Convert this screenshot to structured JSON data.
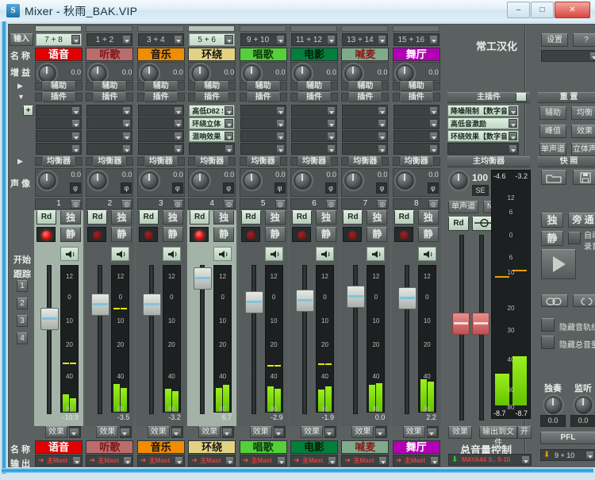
{
  "window": {
    "title": "Mixer -  秋雨_BAK.VIP",
    "logo": "S",
    "minimize": "–",
    "maximize": "□",
    "close": "✕"
  },
  "branding": "常工汉化",
  "toolbar": {
    "settings": "设置",
    "help": "?",
    "preset": ""
  },
  "left_labels": {
    "input": "输入",
    "name": "名 称",
    "gain": "增 益",
    "aux_toggle": "▶",
    "plugin_toggle": "▼",
    "add": "+",
    "eq_toggle": "▶",
    "pan": "声 像",
    "start": "开始",
    "track": "跟踪",
    "track_buttons": [
      "1",
      "2",
      "3",
      "4"
    ],
    "name_bottom": "名 称",
    "output": "输 出"
  },
  "headers": {
    "aux": "辅助",
    "plugin": "插件",
    "eq": "均衡器"
  },
  "meter_scale": [
    "12",
    "0",
    "10",
    "20",
    "40",
    "80"
  ],
  "meter_scale_pos": [
    9,
    35,
    65,
    95,
    135,
    176
  ],
  "master_meter_scale": [
    "12",
    "6",
    "0",
    "6",
    "10",
    "20",
    "30",
    "40",
    "60",
    "80"
  ],
  "master_meter_scale_pos": [
    30,
    48,
    77,
    105,
    124,
    169,
    197,
    234,
    272,
    294
  ],
  "channels": [
    {
      "num": "1",
      "input": "7 + 8",
      "name": "语音",
      "color": "#e00000",
      "text_color": "#ffffff",
      "gain": "0.0",
      "pan": "0.0",
      "phase": "φ",
      "plugins": [
        "",
        "",
        "",
        ""
      ],
      "rd": "Rd",
      "solo": "独",
      "mute": "静",
      "level": "-10.9",
      "fx": "效果",
      "output": "主Mast",
      "selected": true,
      "record_on": true,
      "fader_center": 370,
      "meter": [
        22,
        17
      ],
      "peak": 122
    },
    {
      "num": "2",
      "input": "1 + 2",
      "name": "听歌",
      "color": "#b96d6d",
      "text_color": "#7d1616",
      "gain": "0.0",
      "pan": "0.0",
      "phase": "φ",
      "plugins": [
        "",
        "",
        "",
        ""
      ],
      "rd": "Rd",
      "solo": "独",
      "mute": "静",
      "level": "-3.5",
      "fx": "效果",
      "output": "主Mast",
      "selected": false,
      "record_on": false,
      "fader_center": 352,
      "meter": [
        35,
        30
      ],
      "peak": 53
    },
    {
      "num": "3",
      "input": "3 + 4",
      "name": "音乐",
      "color": "#f08c00",
      "text_color": "#101010",
      "gain": "0.0",
      "pan": "0.0",
      "phase": "φ",
      "plugins": [
        "",
        "",
        "",
        ""
      ],
      "rd": "Rd",
      "solo": "独",
      "mute": "静",
      "level": "-3.2",
      "fx": "效果",
      "output": "主Mast",
      "selected": false,
      "record_on": false,
      "fader_center": 352,
      "meter": [
        29,
        26
      ],
      "peak": null
    },
    {
      "num": "4",
      "input": "5 + 6",
      "name": "环绕",
      "color": "#e2d283",
      "text_color": "#161616",
      "gain": "0.0",
      "pan": "0.0",
      "phase": "φ",
      "plugins": [
        "高低D82 S",
        "环绕立体",
        "混响效果",
        ""
      ],
      "rd": "Rd",
      "solo": "独",
      "mute": "静",
      "level": "6.7",
      "fx": "效果",
      "output": "主Mast",
      "selected": true,
      "record_on": true,
      "fader_center": 319,
      "meter": [
        30,
        34
      ],
      "peak": null
    },
    {
      "num": "5",
      "input": "9 + 10",
      "name": "唱歌",
      "color": "#54d039",
      "text_color": "#103810",
      "gain": "0.0",
      "pan": "0.0",
      "phase": "φ",
      "plugins": [
        "",
        "",
        "",
        ""
      ],
      "rd": "Rd",
      "solo": "独",
      "mute": "静",
      "level": "-2.9",
      "fx": "效果",
      "output": "主Mast",
      "selected": false,
      "record_on": false,
      "fader_center": 349,
      "meter": [
        32,
        29
      ],
      "peak": 125
    },
    {
      "num": "6",
      "input": "11 + 12",
      "name": "电影",
      "color": "#00803a",
      "text_color": "#0a1a0a",
      "gain": "0.0",
      "pan": "0.0",
      "phase": "φ",
      "plugins": [
        "",
        "",
        "",
        ""
      ],
      "rd": "Rd",
      "solo": "独",
      "mute": "静",
      "level": "-1.9",
      "fx": "效果",
      "output": "主Mast",
      "selected": false,
      "record_on": false,
      "fader_center": 347,
      "meter": [
        28,
        32
      ],
      "peak": 123
    },
    {
      "num": "7",
      "input": "13 + 14",
      "name": "喊麦",
      "color": "#7fab8c",
      "text_color": "#8b1a1a",
      "gain": "0.0",
      "pan": "0.0",
      "phase": "φ",
      "plugins": [
        "",
        "",
        "",
        ""
      ],
      "rd": "Rd",
      "solo": "独",
      "mute": "静",
      "level": "0.0",
      "fx": "效果",
      "output": "主Mast",
      "selected": false,
      "record_on": false,
      "fader_center": 342,
      "meter": [
        34,
        36
      ],
      "peak": null
    },
    {
      "num": "8",
      "input": "15 + 16",
      "name": "舞厅",
      "color": "#b400b4",
      "text_color": "#ffffff",
      "gain": "0.0",
      "pan": "0.0",
      "phase": "φ",
      "plugins": [
        "",
        "",
        "",
        ""
      ],
      "rd": "Rd",
      "solo": "独",
      "mute": "静",
      "level": "2.2",
      "fx": "效果",
      "output": "主Mast",
      "selected": false,
      "record_on": false,
      "fader_center": 344,
      "meter": [
        41,
        38
      ],
      "peak": null
    }
  ],
  "master": {
    "plugin_header": "主插件",
    "plugins": [
      "降噪限制【数字音",
      "高低音激励",
      "环绕效果【数字音",
      ""
    ],
    "eq_header": "主均衡器",
    "eq_value": "100",
    "se": "SE",
    "mono": "单声道",
    "n": "N",
    "rd": "Rd",
    "top_left": "-4.6",
    "top_right": "-3.2",
    "bottom_left": "-8.7",
    "bottom_right": "-8.7",
    "fx": "效果",
    "out_to_file": "输出到文件",
    "on": "开",
    "volume_label": "总音量控制",
    "output": "MAYA44 S..  9-10"
  },
  "right_panel": {
    "reset_header": "重 置",
    "reset_buttons": [
      "辅助",
      "均衡",
      "峰值",
      "效果",
      "单声道",
      "立体声"
    ],
    "snapshot_header": "快 照",
    "solo": "独",
    "bypass": "旁 通",
    "mute": "静",
    "auto": "自动",
    "record": "录音",
    "hide_group": "隐藏音轨组",
    "hide_master": "隐藏总音量",
    "solo_label": "独奏",
    "monitor_label": "监听",
    "solo_value": "0.0",
    "monitor_value": "0.0",
    "pfl": "PFL",
    "output": "9 + 10"
  }
}
